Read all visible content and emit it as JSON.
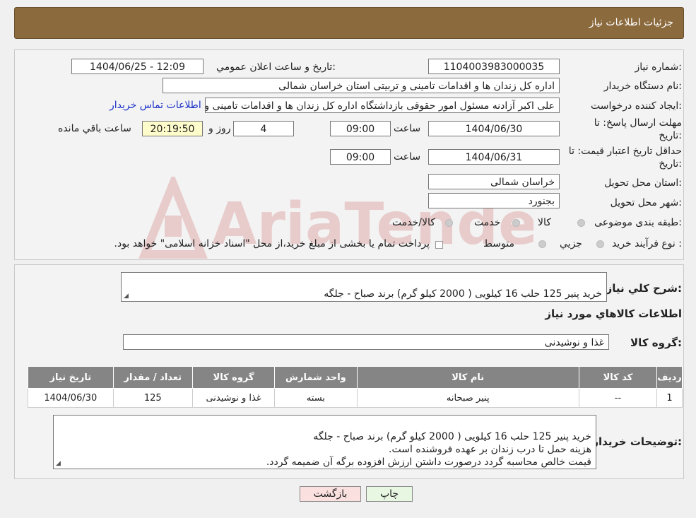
{
  "header": {
    "title": "جزئیات اطلاعات نیاز"
  },
  "watermark": {
    "text": "AriaTender.neT"
  },
  "form": {
    "need_number": {
      "label": "شماره نیاز:",
      "value": "1104003983000035"
    },
    "announce_datetime": {
      "label": "تاریخ و ساعت اعلان عمومي:",
      "value": "1404/06/25 - 12:09"
    },
    "buyer_org": {
      "label": "نام دستگاه خريدار:",
      "value": "اداره کل زندان ها و اقدامات تامینی و تربیتی استان خراسان شمالی"
    },
    "requester": {
      "label": "ايجاد کننده درخواست:",
      "value": "علی اکبر  آزادنه مسئول امور حقوقی بازداشتگاه اداره کل زندان ها و اقدامات تامینی و تربیتی",
      "contact_link": "اطلاعات تماس خریدار"
    },
    "reply_deadline": {
      "label_line1": "مهلت ارسال پاسخ: تا",
      "label_line2": "تاریخ:",
      "date": "1404/06/30",
      "time_label": "ساعت",
      "time": "09:00",
      "days": "4",
      "days_label": "روز و",
      "remaining": "20:19:50",
      "remaining_label": "ساعت باقي مانده"
    },
    "price_validity": {
      "label_line1": "حداقل تاريخ اعتبار قيمت: تا",
      "label_line2": "تاريخ:",
      "date": "1404/06/31",
      "time_label": "ساعت",
      "time": "09:00"
    },
    "delivery_province": {
      "label": "استان محل تحويل:",
      "value": "خراسان شمالی"
    },
    "delivery_city": {
      "label": "شهر محل تحويل:",
      "value": "بجنورد"
    },
    "category": {
      "label": "طبقه بندی موضوعی:",
      "options": [
        "کالا",
        "خدمت",
        "کالا/خدمت"
      ]
    },
    "purchase_type": {
      "label": "نوع فرآيند خريد :",
      "options": [
        "جزيي",
        "متوسط"
      ],
      "note": "پرداخت تمام یا بخشی از مبلغ خرید،از محل \"اسناد خزانه اسلامی\" خواهد بود."
    }
  },
  "description": {
    "label": "شرح کلي نياز:",
    "value": "خرید پنیر 125 حلب 16 کیلویی ( 2000 کیلو گرم) برند صباح - جلگه"
  },
  "items_section": {
    "title": "اطلاعات کالاهاي مورد نياز",
    "group_label": "گروه کالا:",
    "group_value": "غذا و نوشیدنی"
  },
  "items_table": {
    "columns": [
      "رديف",
      "کد کالا",
      "نام کالا",
      "واحد شمارش",
      "گروه کالا",
      "تعداد / مقدار",
      "تاريخ نياز"
    ],
    "rows": [
      [
        "1",
        "--",
        "پنیر صبحانه",
        "بسته",
        "غذا و نوشیدنی",
        "125",
        "1404/06/30"
      ]
    ]
  },
  "buyer_notes": {
    "label": "توضيحات خريدار:",
    "value": "خرید پنیر 125 حلب 16 کیلویی ( 2000 کیلو گرم) برند صباح - جلگه\nهزینه حمل تا درب زندان بر عهده فروشنده است.\nقیمت خالص محاسبه گردد درصورت داشتن ارزش افزوده برگه آن ضمیمه گردد."
  },
  "buttons": {
    "print": "چاپ",
    "back": "بازگشت"
  }
}
